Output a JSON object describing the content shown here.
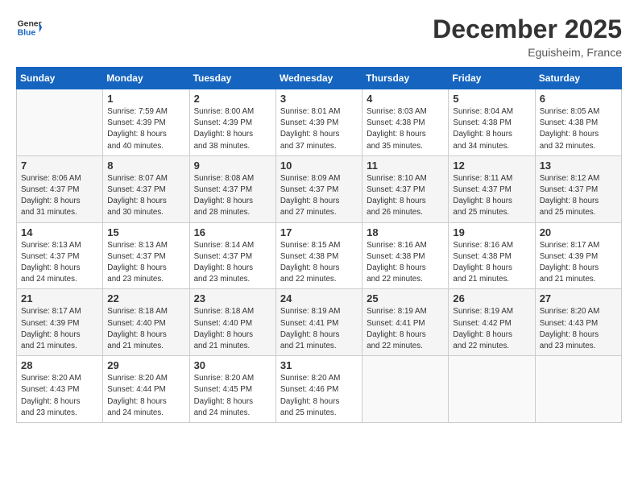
{
  "header": {
    "logo_line1": "General",
    "logo_line2": "Blue",
    "month_year": "December 2025",
    "location": "Eguisheim, France"
  },
  "days_of_week": [
    "Sunday",
    "Monday",
    "Tuesday",
    "Wednesday",
    "Thursday",
    "Friday",
    "Saturday"
  ],
  "weeks": [
    [
      {
        "num": "",
        "info": ""
      },
      {
        "num": "1",
        "info": "Sunrise: 7:59 AM\nSunset: 4:39 PM\nDaylight: 8 hours\nand 40 minutes."
      },
      {
        "num": "2",
        "info": "Sunrise: 8:00 AM\nSunset: 4:39 PM\nDaylight: 8 hours\nand 38 minutes."
      },
      {
        "num": "3",
        "info": "Sunrise: 8:01 AM\nSunset: 4:39 PM\nDaylight: 8 hours\nand 37 minutes."
      },
      {
        "num": "4",
        "info": "Sunrise: 8:03 AM\nSunset: 4:38 PM\nDaylight: 8 hours\nand 35 minutes."
      },
      {
        "num": "5",
        "info": "Sunrise: 8:04 AM\nSunset: 4:38 PM\nDaylight: 8 hours\nand 34 minutes."
      },
      {
        "num": "6",
        "info": "Sunrise: 8:05 AM\nSunset: 4:38 PM\nDaylight: 8 hours\nand 32 minutes."
      }
    ],
    [
      {
        "num": "7",
        "info": "Sunrise: 8:06 AM\nSunset: 4:37 PM\nDaylight: 8 hours\nand 31 minutes."
      },
      {
        "num": "8",
        "info": "Sunrise: 8:07 AM\nSunset: 4:37 PM\nDaylight: 8 hours\nand 30 minutes."
      },
      {
        "num": "9",
        "info": "Sunrise: 8:08 AM\nSunset: 4:37 PM\nDaylight: 8 hours\nand 28 minutes."
      },
      {
        "num": "10",
        "info": "Sunrise: 8:09 AM\nSunset: 4:37 PM\nDaylight: 8 hours\nand 27 minutes."
      },
      {
        "num": "11",
        "info": "Sunrise: 8:10 AM\nSunset: 4:37 PM\nDaylight: 8 hours\nand 26 minutes."
      },
      {
        "num": "12",
        "info": "Sunrise: 8:11 AM\nSunset: 4:37 PM\nDaylight: 8 hours\nand 25 minutes."
      },
      {
        "num": "13",
        "info": "Sunrise: 8:12 AM\nSunset: 4:37 PM\nDaylight: 8 hours\nand 25 minutes."
      }
    ],
    [
      {
        "num": "14",
        "info": "Sunrise: 8:13 AM\nSunset: 4:37 PM\nDaylight: 8 hours\nand 24 minutes."
      },
      {
        "num": "15",
        "info": "Sunrise: 8:13 AM\nSunset: 4:37 PM\nDaylight: 8 hours\nand 23 minutes."
      },
      {
        "num": "16",
        "info": "Sunrise: 8:14 AM\nSunset: 4:37 PM\nDaylight: 8 hours\nand 23 minutes."
      },
      {
        "num": "17",
        "info": "Sunrise: 8:15 AM\nSunset: 4:38 PM\nDaylight: 8 hours\nand 22 minutes."
      },
      {
        "num": "18",
        "info": "Sunrise: 8:16 AM\nSunset: 4:38 PM\nDaylight: 8 hours\nand 22 minutes."
      },
      {
        "num": "19",
        "info": "Sunrise: 8:16 AM\nSunset: 4:38 PM\nDaylight: 8 hours\nand 21 minutes."
      },
      {
        "num": "20",
        "info": "Sunrise: 8:17 AM\nSunset: 4:39 PM\nDaylight: 8 hours\nand 21 minutes."
      }
    ],
    [
      {
        "num": "21",
        "info": "Sunrise: 8:17 AM\nSunset: 4:39 PM\nDaylight: 8 hours\nand 21 minutes."
      },
      {
        "num": "22",
        "info": "Sunrise: 8:18 AM\nSunset: 4:40 PM\nDaylight: 8 hours\nand 21 minutes."
      },
      {
        "num": "23",
        "info": "Sunrise: 8:18 AM\nSunset: 4:40 PM\nDaylight: 8 hours\nand 21 minutes."
      },
      {
        "num": "24",
        "info": "Sunrise: 8:19 AM\nSunset: 4:41 PM\nDaylight: 8 hours\nand 21 minutes."
      },
      {
        "num": "25",
        "info": "Sunrise: 8:19 AM\nSunset: 4:41 PM\nDaylight: 8 hours\nand 22 minutes."
      },
      {
        "num": "26",
        "info": "Sunrise: 8:19 AM\nSunset: 4:42 PM\nDaylight: 8 hours\nand 22 minutes."
      },
      {
        "num": "27",
        "info": "Sunrise: 8:20 AM\nSunset: 4:43 PM\nDaylight: 8 hours\nand 23 minutes."
      }
    ],
    [
      {
        "num": "28",
        "info": "Sunrise: 8:20 AM\nSunset: 4:43 PM\nDaylight: 8 hours\nand 23 minutes."
      },
      {
        "num": "29",
        "info": "Sunrise: 8:20 AM\nSunset: 4:44 PM\nDaylight: 8 hours\nand 24 minutes."
      },
      {
        "num": "30",
        "info": "Sunrise: 8:20 AM\nSunset: 4:45 PM\nDaylight: 8 hours\nand 24 minutes."
      },
      {
        "num": "31",
        "info": "Sunrise: 8:20 AM\nSunset: 4:46 PM\nDaylight: 8 hours\nand 25 minutes."
      },
      {
        "num": "",
        "info": ""
      },
      {
        "num": "",
        "info": ""
      },
      {
        "num": "",
        "info": ""
      }
    ]
  ]
}
